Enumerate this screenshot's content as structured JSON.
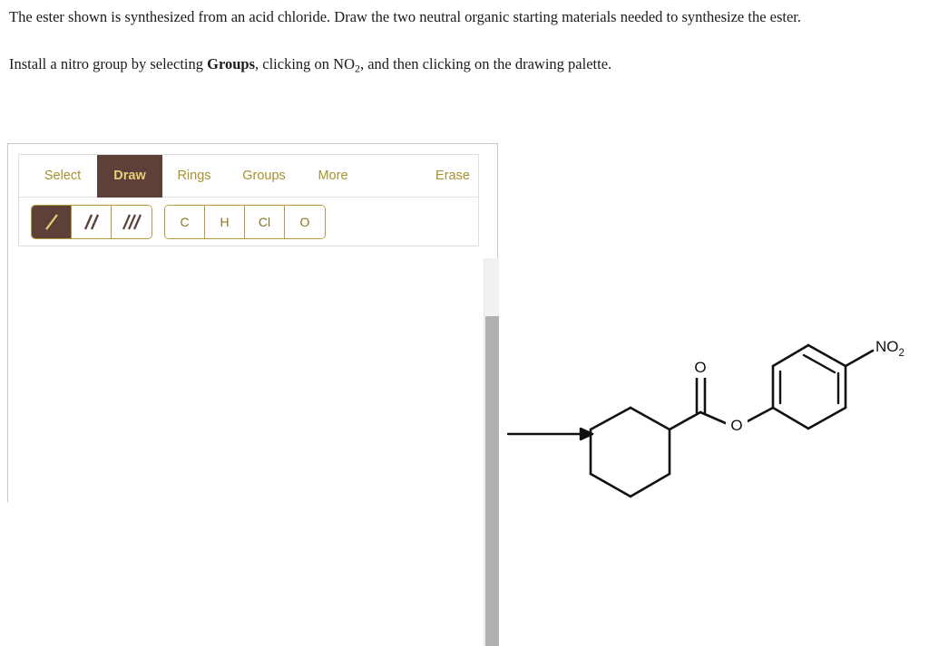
{
  "question": {
    "paragraph1_part1": "The ester shown is synthesized from an acid chloride. Draw the two neutral organic starting materials needed to synthesize the ester.",
    "paragraph2_part1": "Install a nitro group by selecting ",
    "paragraph2_bold": "Groups",
    "paragraph2_part2": ", clicking on NO",
    "paragraph2_sub": "2",
    "paragraph2_part3": ", and then clicking on the drawing palette."
  },
  "editor": {
    "tabs": [
      {
        "label": "Select",
        "active": false
      },
      {
        "label": "Draw",
        "active": true
      },
      {
        "label": "Rings",
        "active": false
      },
      {
        "label": "Groups",
        "active": false
      },
      {
        "label": "More",
        "active": false
      }
    ],
    "erase_label": "Erase",
    "bond_tools": [
      {
        "name": "single-bond",
        "active": true
      },
      {
        "name": "double-bond",
        "active": false
      },
      {
        "name": "triple-bond",
        "active": false
      }
    ],
    "atom_tools": [
      "C",
      "H",
      "Cl",
      "O"
    ],
    "colors": {
      "accent_dark": "#5d4037",
      "accent_gold": "#e8cf7a",
      "label_gold": "#a8912f",
      "border_gold": "#b59a3b"
    }
  },
  "molecule": {
    "name": "4-nitrophenyl cyclohexanecarboxylate",
    "arrow": "reaction-arrow",
    "labels": {
      "carbonyl_oxygen": "O",
      "ester_oxygen": "O",
      "nitro_main": "NO",
      "nitro_sub": "2"
    }
  }
}
